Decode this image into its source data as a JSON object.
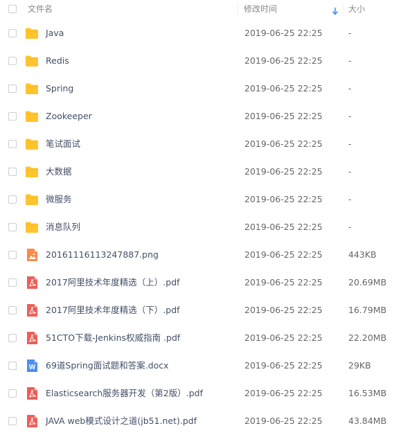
{
  "header": {
    "name_label": "文件名",
    "time_label": "修改时间",
    "size_label": "大小",
    "sort_icon": "arrow-down-icon",
    "sort_color": "#3b8cff"
  },
  "colors": {
    "folder": "#ffc42e",
    "pdf": "#ec5f59",
    "image": "#f98b4c",
    "word": "#4d8ef0"
  },
  "files": [
    {
      "type": "folder",
      "icon": "folder-icon",
      "name": "Java",
      "time": "2019-06-25 22:25",
      "size": "-"
    },
    {
      "type": "folder",
      "icon": "folder-icon",
      "name": "Redis",
      "time": "2019-06-25 22:25",
      "size": "-"
    },
    {
      "type": "folder",
      "icon": "folder-icon",
      "name": "Spring",
      "time": "2019-06-25 22:25",
      "size": "-"
    },
    {
      "type": "folder",
      "icon": "folder-icon",
      "name": "Zookeeper",
      "time": "2019-06-25 22:25",
      "size": "-"
    },
    {
      "type": "folder",
      "icon": "folder-icon",
      "name": "笔试面试",
      "time": "2019-06-25 22:25",
      "size": "-"
    },
    {
      "type": "folder",
      "icon": "folder-icon",
      "name": "大数据",
      "time": "2019-06-25 22:25",
      "size": "-"
    },
    {
      "type": "folder",
      "icon": "folder-icon",
      "name": "微服务",
      "time": "2019-06-25 22:25",
      "size": "-"
    },
    {
      "type": "folder",
      "icon": "folder-icon",
      "name": "消息队列",
      "time": "2019-06-25 22:25",
      "size": "-"
    },
    {
      "type": "image",
      "icon": "image-file-icon",
      "name": "20161116113247887.png",
      "time": "2019-06-25 22:25",
      "size": "443KB"
    },
    {
      "type": "pdf",
      "icon": "pdf-file-icon",
      "name": "2017阿里技术年度精选（上）.pdf",
      "time": "2019-06-25 22:25",
      "size": "20.69MB"
    },
    {
      "type": "pdf",
      "icon": "pdf-file-icon",
      "name": "2017阿里技术年度精选（下）.pdf",
      "time": "2019-06-25 22:25",
      "size": "16.79MB"
    },
    {
      "type": "pdf",
      "icon": "pdf-file-icon",
      "name": "51CTO下载-Jenkins权威指南 .pdf",
      "time": "2019-06-25 22:25",
      "size": "22.20MB"
    },
    {
      "type": "word",
      "icon": "word-file-icon",
      "name": "69道Spring面试题和答案.docx",
      "time": "2019-06-25 22:25",
      "size": "29KB"
    },
    {
      "type": "pdf",
      "icon": "pdf-file-icon",
      "name": "Elasticsearch服务器开发（第2版）.pdf",
      "time": "2019-06-25 22:25",
      "size": "16.53MB"
    },
    {
      "type": "pdf",
      "icon": "pdf-file-icon",
      "name": "JAVA web模式设计之道(jb51.net).pdf",
      "time": "2019-06-25 22:25",
      "size": "43.84MB"
    }
  ]
}
